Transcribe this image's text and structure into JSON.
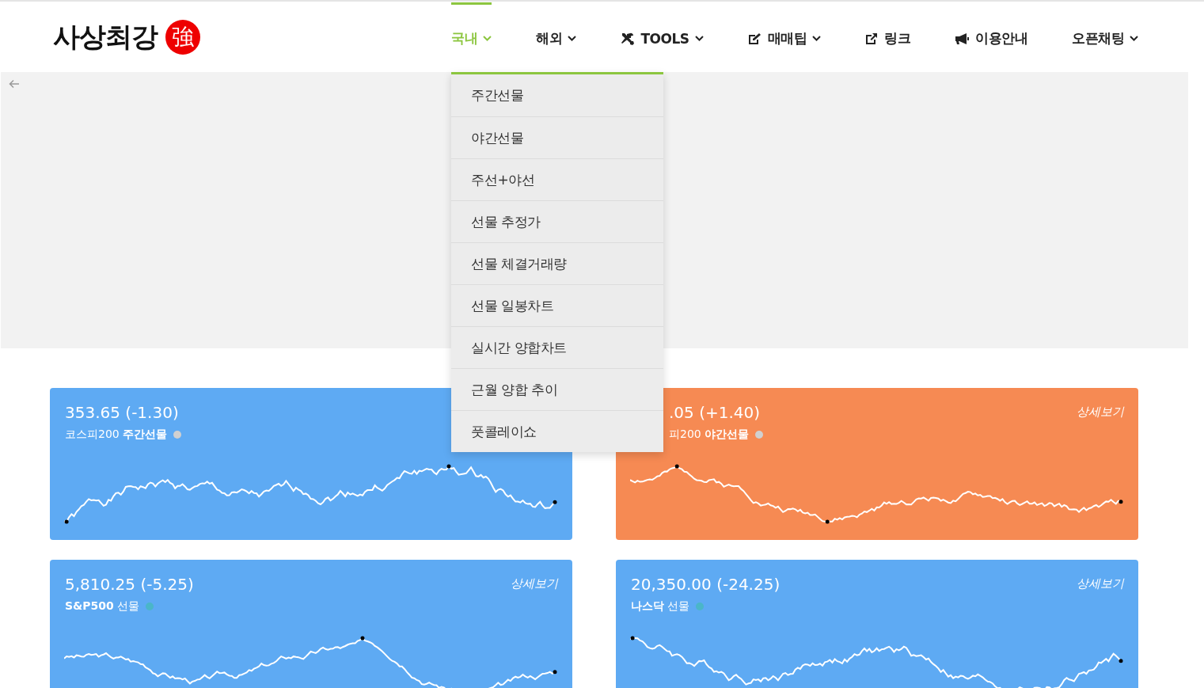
{
  "logo": {
    "text": "사상최강",
    "seal": "強"
  },
  "nav": [
    {
      "label": "국내",
      "selected": true,
      "menu": [
        "주간선물",
        "야간선물",
        "주선+야선",
        "선물 추정가",
        "선물 체결거래량",
        "선물 일봉차트",
        "실시간 양합차트",
        "근월 양합 추이",
        "풋콜레이쇼"
      ]
    },
    {
      "label": "해외",
      "selected": false
    },
    {
      "label": "TOOLS",
      "selected": false
    },
    {
      "label": "매매팁",
      "selected": false
    },
    {
      "label": "링크",
      "selected": false
    },
    {
      "label": "이용안내",
      "selected": false
    },
    {
      "label": "오픈채팅",
      "selected": false
    }
  ],
  "cards": [
    {
      "value": "353.65 (-1.30)",
      "name": "코스피200 **주간선물**",
      "dot": {
        "color": "#d0d0d0"
      },
      "color": "#5eaaf3"
    },
    {
      "value": ".05 (+1.40)",
      "name": "피200 **야간선물**",
      "dot": {
        "color": "#d0d0d0"
      },
      "color": "#f68a53",
      "detail": "상세보기"
    },
    {
      "value": "5,810.25 (-5.25)",
      "name": "**S&P500** 선물",
      "dot": {
        "color": "#4ab6c8"
      },
      "color": "#5eaaf3",
      "detail": "상세보기"
    },
    {
      "value": "20,350.00 (-24.25)",
      "name": "**나스닥** 선물",
      "dot": {
        "color": "#4ab6c8"
      },
      "color": "#5eaaf3",
      "detail": "상세보기"
    }
  ]
}
